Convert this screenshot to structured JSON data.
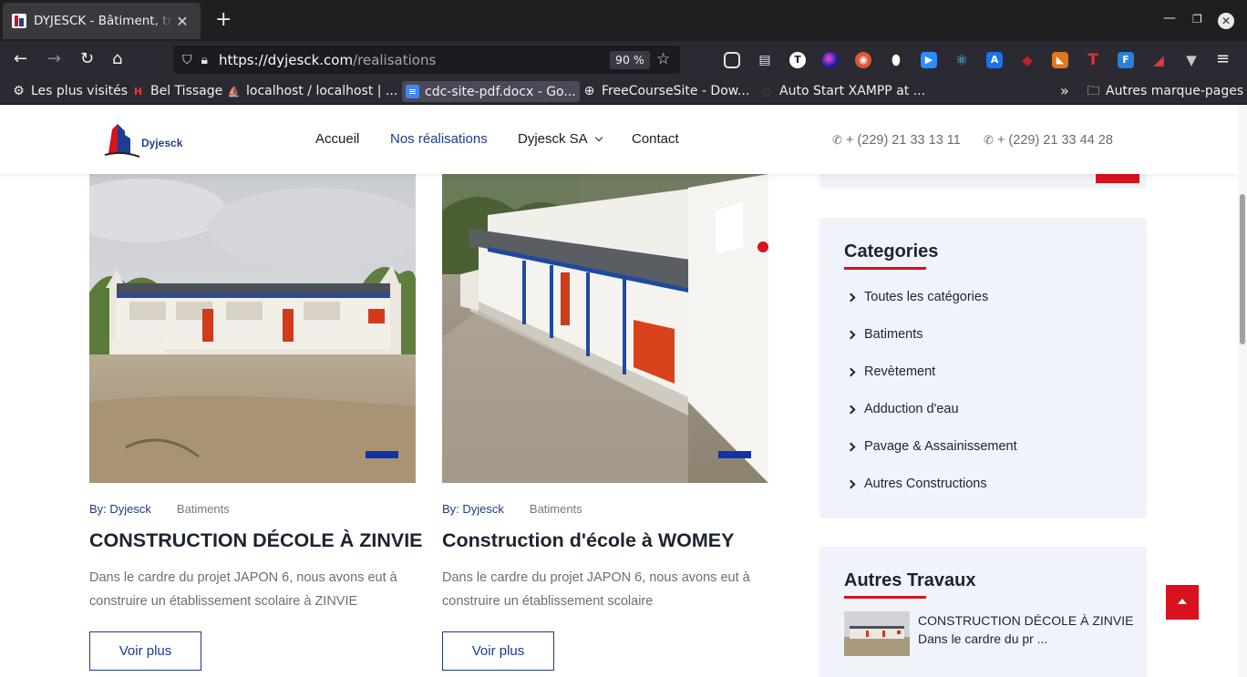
{
  "browser": {
    "tab_title": "DYJESCK - Bâtiment, travaux",
    "url_host": "https://dyjesck.com",
    "url_path": "/realisations",
    "zoom": "90 %",
    "bookmarks": [
      {
        "label": "Les plus visités"
      },
      {
        "label": "Bel Tissage"
      },
      {
        "label": "localhost / localhost | ..."
      },
      {
        "label": "cdc-site-pdf.docx - Go..."
      },
      {
        "label": "FreeCourseSite - Dow..."
      },
      {
        "label": "Auto Start XAMPP at ..."
      }
    ],
    "other_bookmarks": "Autres marque-pages",
    "icons": {
      "back": "back-arrow-icon",
      "forward": "forward-arrow-icon",
      "reload": "reload-icon",
      "home": "home-icon",
      "shield": "tracking-shield-icon",
      "lock": "lock-icon",
      "star": "bookmark-star-icon",
      "menu": "hamburger-menu-icon"
    }
  },
  "header": {
    "logo_text": "Dyjesck",
    "menu": [
      {
        "label": "Accueil"
      },
      {
        "label": "Nos réalisations"
      },
      {
        "label": "Dyjesck SA"
      },
      {
        "label": "Contact"
      }
    ],
    "phones": [
      "+ (229) 21 33 13 11",
      "+ (229) 21 33 44 28"
    ]
  },
  "cards": [
    {
      "author": "By: Dyjesck",
      "category": "Batiments",
      "title": "CONSTRUCTION DÉCOLE À ZINVIE",
      "desc_line1": "Dans le cardre du projet JAPON 6, nous avons eut à",
      "desc_line2": "construire un établissement scolaire à ZINVIE",
      "button": "Voir plus"
    },
    {
      "author": "By: Dyjesck",
      "category": "Batiments",
      "title": "Construction d'école à WOMEY",
      "desc_line1": "Dans le cardre du projet JAPON 6, nous avons eut à",
      "desc_line2": "construire un établissement scolaire",
      "button": "Voir plus"
    }
  ],
  "sidebar": {
    "categories_title": "Categories",
    "categories": [
      {
        "label": "Toutes les catégories"
      },
      {
        "label": "Batiments"
      },
      {
        "label": "Revètement"
      },
      {
        "label": "Adduction d'eau"
      },
      {
        "label": "Pavage & Assainissement"
      },
      {
        "label": "Autres Constructions"
      }
    ],
    "autres_title": "Autres Travaux",
    "autres_item_title": "CONSTRUCTION DÉCOLE À ZINVIE",
    "autres_item_desc": "Dans le cardre du pr ..."
  },
  "colors": {
    "brand_blue": "#1d3a8a",
    "brand_red": "#d8121e",
    "sidebar_bg": "#f0f4fa"
  }
}
